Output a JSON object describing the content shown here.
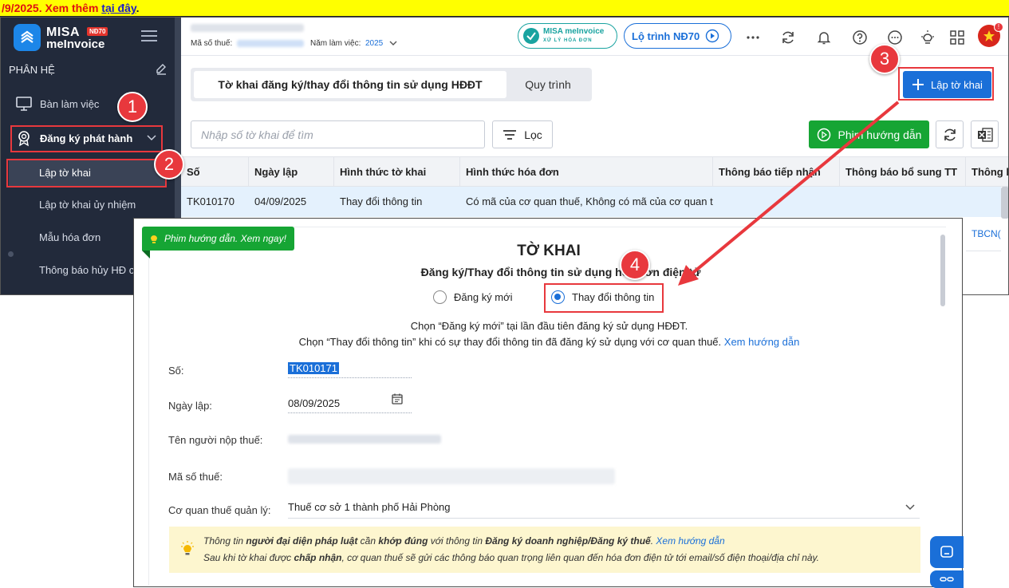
{
  "banner": {
    "text_red": "/9/2025. Xem thêm ",
    "link": "tại đây",
    "tail": "."
  },
  "sidebar": {
    "brand_line1": "MISA",
    "brand_line2": "meInvoice",
    "brand_badge": "NĐ70",
    "section": "PHÂN HỆ",
    "items": [
      {
        "label": "Bàn làm việc",
        "icon": "monitor-icon"
      },
      {
        "label": "Đăng ký phát hành",
        "icon": "certificate-icon"
      }
    ],
    "subitems": [
      {
        "label": "Lập tờ khai",
        "active": true
      },
      {
        "label": "Lập tờ khai ủy nhiệm"
      },
      {
        "label": "Mẫu hóa đơn"
      },
      {
        "label": "Thông báo hủy HĐ c"
      }
    ]
  },
  "topbar": {
    "mst_label": "Mã số thuế:",
    "year_label": "Năm làm việc:",
    "year_value": "2025",
    "pill_misa": "MISA meInvoice",
    "pill_misa_sub": "XỬ LÝ HÓA ĐƠN",
    "pill_road": "Lộ trình NĐ70",
    "notif_count": "!"
  },
  "tabs": [
    {
      "label": "Tờ khai đăng ký/thay đổi thông tin sử dụng HĐĐT"
    },
    {
      "label": "Quy trình"
    }
  ],
  "toolbar": {
    "create_label": "Lập tờ khai",
    "search_placeholder": "Nhập số tờ khai để tìm",
    "filter_label": "Lọc",
    "video_label": "Phim hướng dẫn"
  },
  "table": {
    "columns": [
      "Số",
      "Ngày lập",
      "Hình thức tờ khai",
      "Hình thức hóa đơn",
      "Thông báo tiếp nhận",
      "Thông báo bổ sung TT",
      "Thông b"
    ],
    "rows": [
      [
        "TK010170",
        "04/09/2025",
        "Thay đổi thông tin",
        "Có mã của cơ quan thuế, Không có mã của cơ quan th...",
        "",
        "",
        ""
      ]
    ],
    "partial_cell": "TBCN("
  },
  "dialog": {
    "help_ribbon": "Phim hướng dẫn. Xem ngay!",
    "title": "TỜ KHAI",
    "subtitle": "Đăng ký/Thay đổi thông tin sử dụng hóa đơn điện tử",
    "radio_new": "Đăng ký mới",
    "radio_change": "Thay đổi thông tin",
    "note1": "Chọn “Đăng ký mới” tại lần đầu tiên đăng ký sử dụng HĐĐT.",
    "note2": "Chọn “Thay đổi thông tin” khi có sự thay đổi thông tin đã đăng ký sử dụng với cơ quan thuế.",
    "note2_link": "Xem hướng dẫn",
    "fields": {
      "so_label": "Số:",
      "so_value": "TK010171",
      "ngay_label": "Ngày lập:",
      "ngay_value": "08/09/2025",
      "ten_label": "Tên người nộp thuế:",
      "mst_label": "Mã số thuế:",
      "cq_label": "Cơ quan thuế quản lý:",
      "cq_value": "Thuế cơ sở 1 thành phố Hải Phòng"
    },
    "info": {
      "l1_a": "Thông tin ",
      "l1_b": "người đại diện pháp luật",
      "l1_c": " cần ",
      "l1_d": "khớp đúng",
      "l1_e": " với thông tin ",
      "l1_f": "Đăng ký doanh nghiệp/Đăng ký thuế",
      ". ": "",
      "l1_link": "Xem hướng dẫn",
      "l2_a": "Sau khi tờ khai được ",
      "l2_b": "chấp nhận",
      "l2_c": ", cơ quan thuế sẽ gửi các thông báo quan trọng liên quan đến hóa đơn điện tử tới email/số điện thoại/địa chỉ này."
    }
  },
  "callouts": [
    "1",
    "2",
    "3",
    "4"
  ],
  "colors": {
    "accent": "#1a6fd8",
    "green": "#16a534",
    "red": "#e8383d",
    "sidebar": "#222a3b"
  }
}
